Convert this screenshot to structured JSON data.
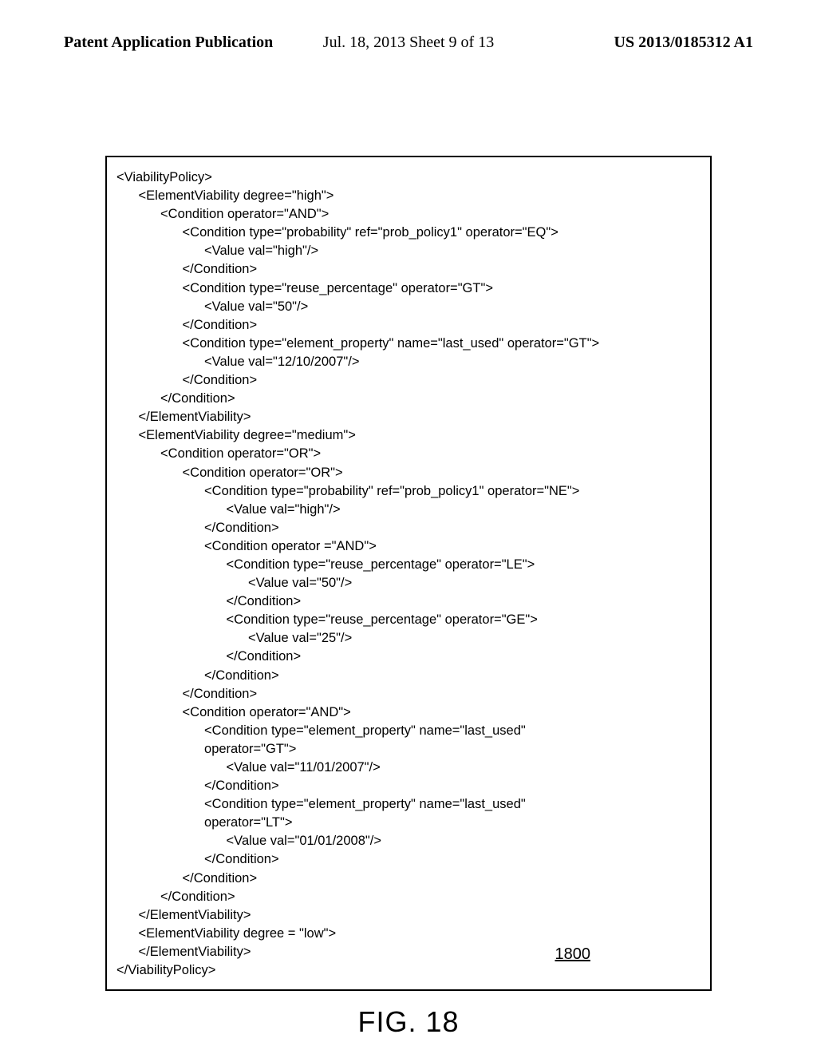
{
  "header": {
    "left": "Patent Application Publication",
    "center": "Jul. 18, 2013  Sheet 9 of 13",
    "right": "US 2013/0185312 A1"
  },
  "code": {
    "l0": "<ViabilityPolicy>",
    "l1": "<ElementViability degree=\"high\">",
    "l2": "<Condition operator=\"AND\">",
    "l3": "<Condition type=\"probability\" ref=\"prob_policy1\" operator=\"EQ\">",
    "l4": "<Value val=\"high\"/>",
    "l5": "</Condition>",
    "l6": "<Condition type=\"reuse_percentage\" operator=\"GT\">",
    "l7": "<Value val=\"50\"/>",
    "l8": "</Condition>",
    "l9": "<Condition type=\"element_property\" name=\"last_used\" operator=\"GT\">",
    "l10": "<Value val=\"12/10/2007\"/>",
    "l11": "</Condition>",
    "l12": "</Condition>",
    "l13": "</ElementViability>",
    "l14": "<ElementViability degree=\"medium\">",
    "l15": "<Condition operator=\"OR\">",
    "l16": "<Condition operator=\"OR\">",
    "l17": "<Condition type=\"probability\" ref=\"prob_policy1\" operator=\"NE\">",
    "l18": "<Value val=\"high\"/>",
    "l19": "</Condition>",
    "l20": "<Condition operator =\"AND\">",
    "l21": "<Condition type=\"reuse_percentage\" operator=\"LE\">",
    "l22": "<Value val=\"50\"/>",
    "l23": "</Condition>",
    "l24": "<Condition type=\"reuse_percentage\" operator=\"GE\">",
    "l25": "<Value val=\"25\"/>",
    "l26": "</Condition>",
    "l27": "</Condition>",
    "l28": "</Condition>",
    "l29": "<Condition operator=\"AND\">",
    "l30": "<Condition type=\"element_property\" name=\"last_used\"",
    "l31": "operator=\"GT\">",
    "l32": "<Value val=\"11/01/2007\"/>",
    "l33": "</Condition>",
    "l34": "<Condition type=\"element_property\" name=\"last_used\"",
    "l35": "operator=\"LT\">",
    "l36": "<Value val=\"01/01/2008\"/>",
    "l37": "</Condition>",
    "l38": "</Condition>",
    "l39": "</Condition>",
    "l40": "</ElementViability>",
    "l41": "<ElementViability degree = \"low\">",
    "l42": "</ElementViability>",
    "l43": "</ViabilityPolicy>"
  },
  "figure": {
    "ref": "1800",
    "caption": "FIG. 18"
  }
}
